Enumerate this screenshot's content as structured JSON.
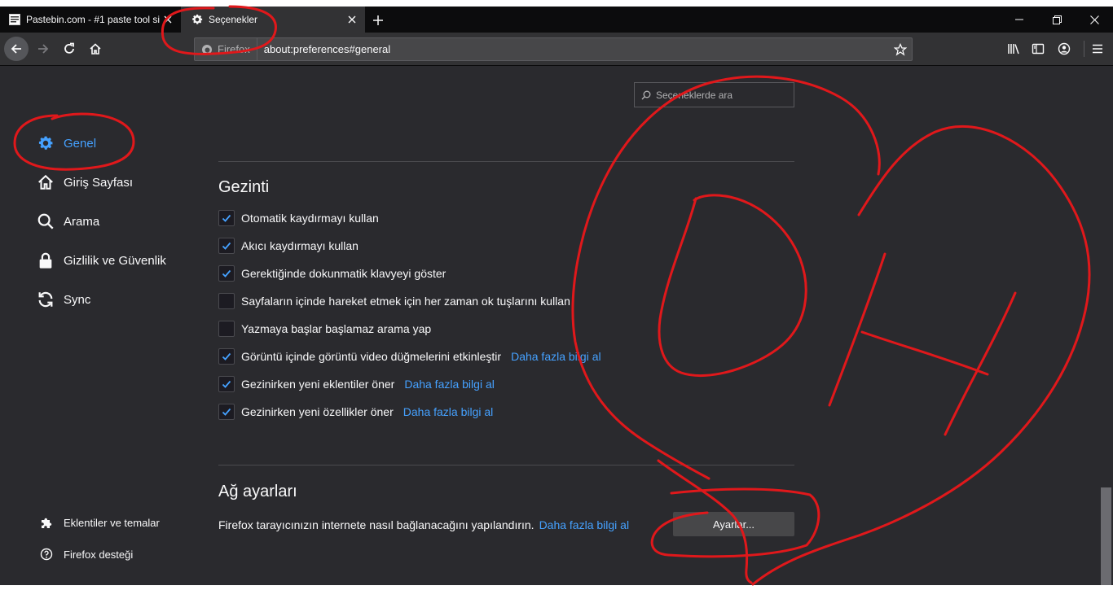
{
  "tabs": [
    {
      "title": "Pastebin.com - #1 paste tool si",
      "active": false
    },
    {
      "title": "Seçenekler",
      "active": true
    }
  ],
  "urlbar": {
    "identity_label": "Firefox",
    "url": "about:preferences#general"
  },
  "search": {
    "placeholder": "Seçeneklerde ara"
  },
  "sidebar": {
    "categories": [
      {
        "label": "Genel",
        "icon": "gear-icon",
        "selected": true
      },
      {
        "label": "Giriş Sayfası",
        "icon": "home-icon",
        "selected": false
      },
      {
        "label": "Arama",
        "icon": "search-icon",
        "selected": false
      },
      {
        "label": "Gizlilik ve Güvenlik",
        "icon": "lock-icon",
        "selected": false
      },
      {
        "label": "Sync",
        "icon": "sync-icon",
        "selected": false
      }
    ],
    "footer": [
      {
        "label": "Eklentiler ve temalar",
        "icon": "puzzle-icon"
      },
      {
        "label": "Firefox desteği",
        "icon": "help-icon"
      }
    ]
  },
  "browsing": {
    "heading": "Gezinti",
    "options": [
      {
        "label": "Otomatik kaydırmayı kullan",
        "checked": true,
        "link": ""
      },
      {
        "label": "Akıcı kaydırmayı kullan",
        "checked": true,
        "link": ""
      },
      {
        "label": "Gerektiğinde dokunmatik klavyeyi göster",
        "checked": true,
        "link": ""
      },
      {
        "label": "Sayfaların içinde hareket etmek için her zaman ok tuşlarını kullan",
        "checked": false,
        "link": ""
      },
      {
        "label": "Yazmaya başlar başlamaz arama yap",
        "checked": false,
        "link": ""
      },
      {
        "label": "Görüntü içinde görüntü video düğmelerini etkinleştir",
        "checked": true,
        "link": "Daha fazla bilgi al"
      },
      {
        "label": "Gezinirken yeni eklentiler öner",
        "checked": true,
        "link": "Daha fazla bilgi al"
      },
      {
        "label": "Gezinirken yeni özellikler öner",
        "checked": true,
        "link": "Daha fazla bilgi al"
      }
    ]
  },
  "network": {
    "heading": "Ağ ayarları",
    "description": "Firefox tarayıcınızın internete nasıl bağlanacağını yapılandırın.",
    "link": "Daha fazla bilgi al",
    "button": "Ayarlar..."
  },
  "colors": {
    "accent": "#45a1ff",
    "background": "#2a2a2e",
    "annotation": "#e0181b"
  }
}
